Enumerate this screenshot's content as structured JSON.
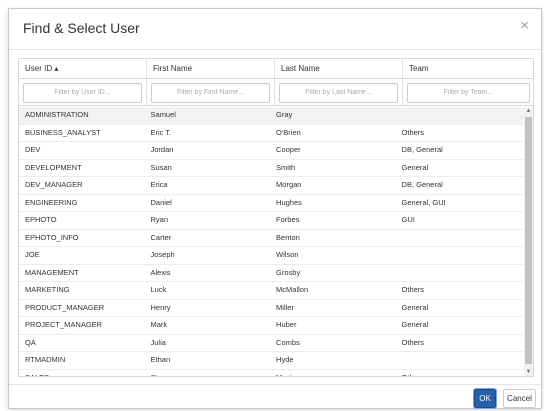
{
  "dialog": {
    "title": "Find & Select User",
    "close_glyph": "×",
    "ok_label": "OK",
    "cancel_label": "Cancel"
  },
  "columns": [
    {
      "label": "User ID ▴",
      "filter_placeholder": "Filter by User ID..."
    },
    {
      "label": "First Name",
      "filter_placeholder": "Filter by First Name..."
    },
    {
      "label": "Last Name",
      "filter_placeholder": "Filter by Last Name..."
    },
    {
      "label": "Team",
      "filter_placeholder": "Filter by Team..."
    }
  ],
  "rows": [
    [
      "ADMINISTRATION",
      "Samuel",
      "Gray",
      ""
    ],
    [
      "BUSINESS_ANALYST",
      "Eric T.",
      "O'Brien",
      "Others"
    ],
    [
      "DEV",
      "Jordan",
      "Cooper",
      "DB, General"
    ],
    [
      "DEVELOPMENT",
      "Susan",
      "Smith",
      "General"
    ],
    [
      "DEV_MANAGER",
      "Erica",
      "Morgan",
      "DB, General"
    ],
    [
      "ENGINEERING",
      "Daniel",
      "Hughes",
      "General, GUI"
    ],
    [
      "EPHOTO",
      "Ryan",
      "Forbes",
      "GUI"
    ],
    [
      "EPHOTO_INFO",
      "Carter",
      "Benton",
      ""
    ],
    [
      "JOE",
      "Joseph",
      "Wilson",
      ""
    ],
    [
      "MANAGEMENT",
      "Alexis",
      "Grosby",
      ""
    ],
    [
      "MARKETING",
      "Luck",
      "McMallon",
      "Others"
    ],
    [
      "PRODUCT_MANAGER",
      "Henry",
      "Miller",
      "General"
    ],
    [
      "PROJECT_MANAGER",
      "Mark",
      "Huber",
      "General"
    ],
    [
      "QA",
      "Julia",
      "Combs",
      "Others"
    ],
    [
      "RTMADMIN",
      "Ethan",
      "Hyde",
      ""
    ],
    [
      "SALES",
      "Steve",
      "Martin",
      "Others"
    ]
  ],
  "scrollbar": {
    "up": "▲",
    "down": "▼"
  }
}
